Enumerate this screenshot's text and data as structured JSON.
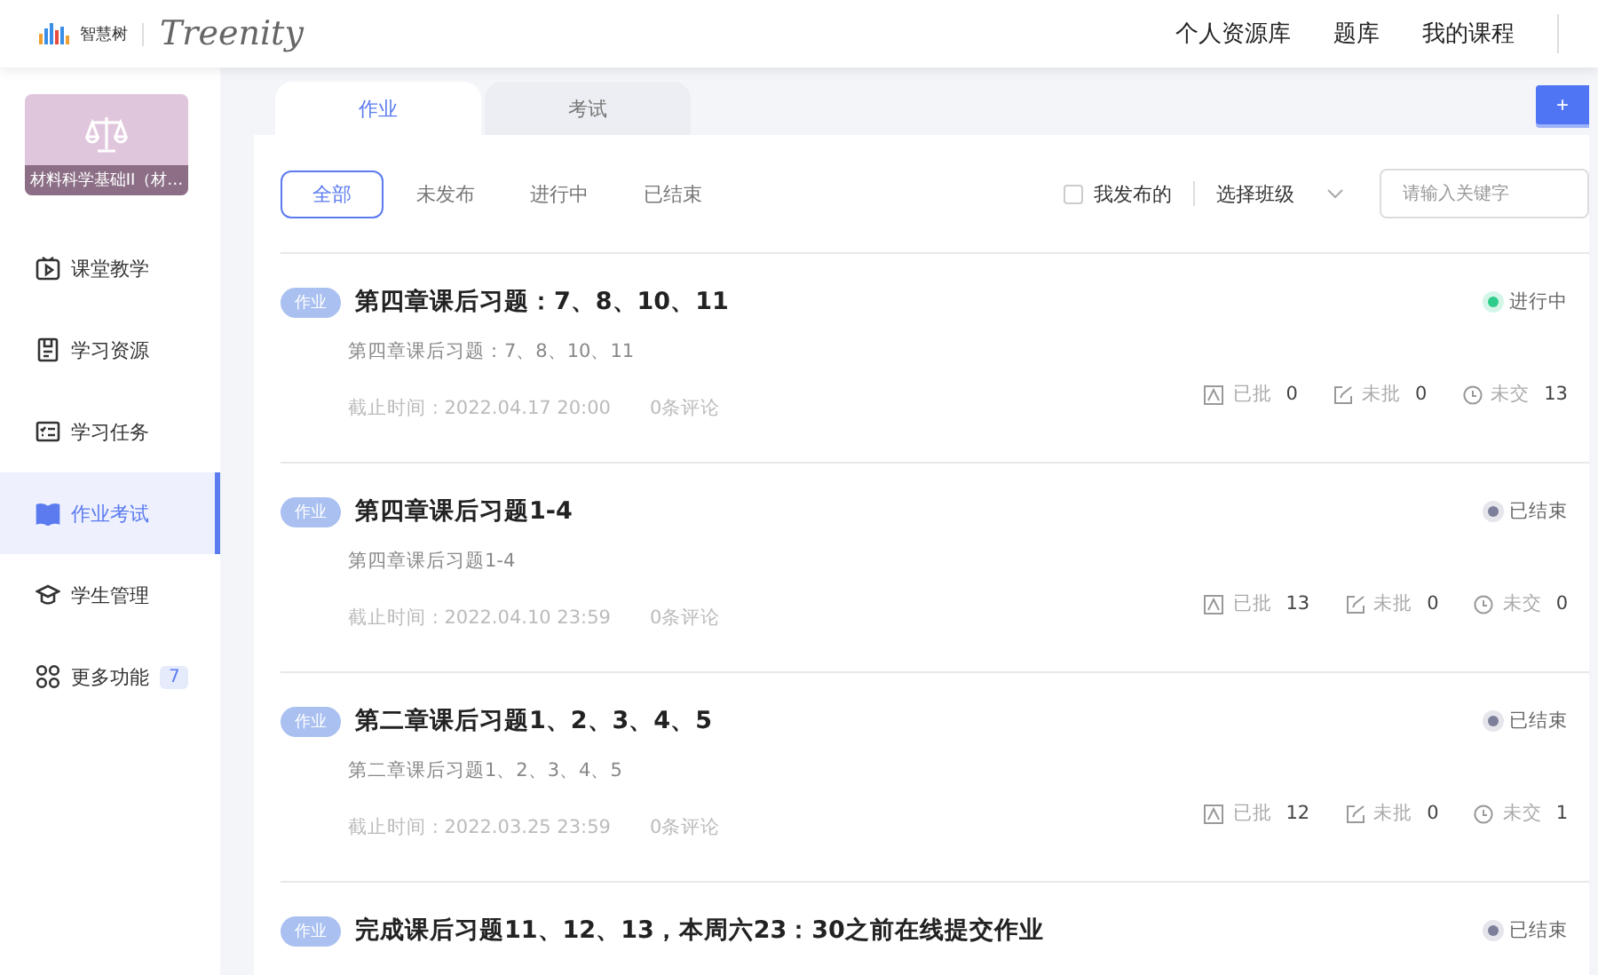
{
  "header": {
    "logo_text": "智慧树",
    "brand": "Treenity",
    "nav": [
      "个人资源库",
      "题库",
      "我的课程"
    ]
  },
  "sidebar": {
    "course": {
      "title": "材料科学基础II（材…"
    },
    "items": [
      {
        "kind": "classroom",
        "label": "课堂教学",
        "selected": false
      },
      {
        "kind": "resources",
        "label": "学习资源",
        "selected": false
      },
      {
        "kind": "tasks",
        "label": "学习任务",
        "selected": false
      },
      {
        "kind": "homework",
        "label": "作业考试",
        "selected": true
      },
      {
        "kind": "students",
        "label": "学生管理",
        "selected": false
      },
      {
        "kind": "more",
        "label": "更多功能",
        "selected": false,
        "badge": "7"
      }
    ]
  },
  "tabs": [
    {
      "label": "作业",
      "selected": true
    },
    {
      "label": "考试",
      "selected": false
    }
  ],
  "add_button": "+",
  "filters": [
    {
      "label": "全部",
      "selected": true
    },
    {
      "label": "未发布",
      "selected": false
    },
    {
      "label": "进行中",
      "selected": false
    },
    {
      "label": "已结束",
      "selected": false
    }
  ],
  "my_published": {
    "label": "我发布的",
    "checked": false
  },
  "class_select": {
    "label": "选择班级"
  },
  "search": {
    "placeholder": "请输入关键字"
  },
  "assignments": [
    {
      "tag": "作业",
      "title": "第四章课后习题：7、8、10、11",
      "description": "第四章课后习题：7、8、10、11",
      "deadline": "截止时间 : 2022.04.17 20:00",
      "comments": "0条评论",
      "status": {
        "label": "进行中",
        "color": "#2ecc8a"
      },
      "stats": [
        {
          "kind": "graded",
          "label": "已批",
          "value": "0"
        },
        {
          "kind": "ungraded",
          "label": "未批",
          "value": "0"
        },
        {
          "kind": "unsubmitted",
          "label": "未交",
          "value": "13"
        }
      ]
    },
    {
      "tag": "作业",
      "title": "第四章课后习题1-4",
      "description": "第四章课后习题1-4",
      "deadline": "截止时间 : 2022.04.10 23:59",
      "comments": "0条评论",
      "status": {
        "label": "已结束",
        "color": "#7c7f99"
      },
      "stats": [
        {
          "kind": "graded",
          "label": "已批",
          "value": "13"
        },
        {
          "kind": "ungraded",
          "label": "未批",
          "value": "0"
        },
        {
          "kind": "unsubmitted",
          "label": "未交",
          "value": "0"
        }
      ]
    },
    {
      "tag": "作业",
      "title": "第二章课后习题1、2、3、4、5",
      "description": "第二章课后习题1、2、3、4、5",
      "deadline": "截止时间 : 2022.03.25 23:59",
      "comments": "0条评论",
      "status": {
        "label": "已结束",
        "color": "#7c7f99"
      },
      "stats": [
        {
          "kind": "graded",
          "label": "已批",
          "value": "12"
        },
        {
          "kind": "ungraded",
          "label": "未批",
          "value": "0"
        },
        {
          "kind": "unsubmitted",
          "label": "未交",
          "value": "1"
        }
      ]
    },
    {
      "tag": "作业",
      "title": "完成课后习题11、12、13，本周六23：30之前在线提交作业",
      "status": {
        "label": "已结束",
        "color": "#7c7f99"
      }
    }
  ]
}
